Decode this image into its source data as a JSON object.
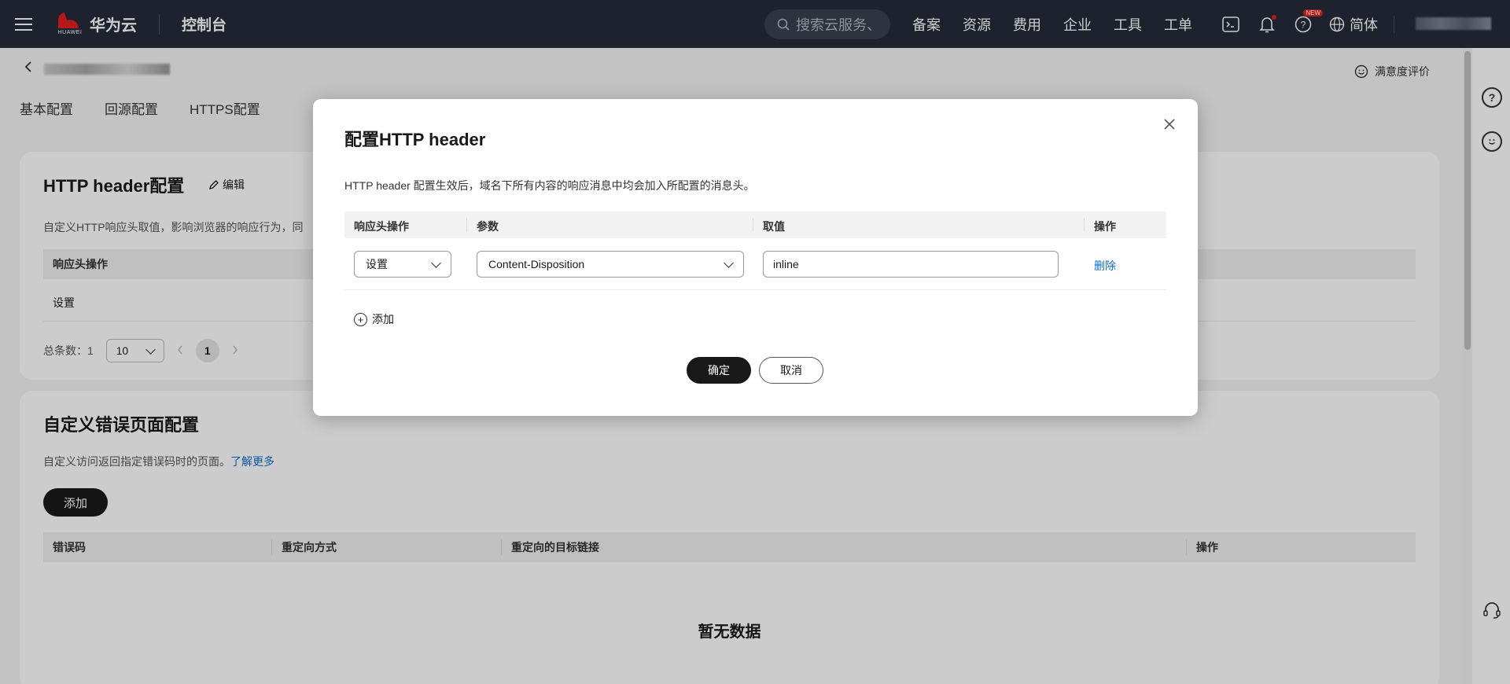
{
  "topnav": {
    "logo_text": "华为云",
    "logo_sub": "HUAWEI",
    "console": "控制台",
    "search_placeholder": "搜索云服务、",
    "links": [
      "备案",
      "资源",
      "费用",
      "企业",
      "工具",
      "工单"
    ],
    "new_badge": "NEW",
    "lang": "简体"
  },
  "page": {
    "satisfaction": "满意度评价",
    "tabs": [
      "基本配置",
      "回源配置",
      "HTTPS配置"
    ],
    "http_card": {
      "title": "HTTP header配置",
      "edit": "编辑",
      "desc": "自定义HTTP响应头取值，影响浏览器的响应行为，同",
      "col_op": "响应头操作",
      "row_op": "设置",
      "total_label": "总条数：1",
      "page_size": "10",
      "current_page": "1"
    },
    "error_card": {
      "title": "自定义错误页面配置",
      "desc": "自定义访问返回指定错误码时的页面。",
      "learn_more": "了解更多",
      "add_button": "添加",
      "columns": [
        "错误码",
        "重定向方式",
        "重定向的目标链接",
        "操作"
      ],
      "no_data": "暂无数据"
    }
  },
  "modal": {
    "title": "配置HTTP header",
    "desc": "HTTP header 配置生效后，域名下所有内容的响应消息中均会加入所配置的消息头。",
    "columns": [
      "响应头操作",
      "参数",
      "取值",
      "操作"
    ],
    "row": {
      "operation": "设置",
      "param": "Content-Disposition",
      "value": "inline",
      "delete": "删除"
    },
    "add": "添加",
    "ok": "确定",
    "cancel": "取消"
  },
  "colors": {
    "nav_bg": "#252b3a",
    "primary_btn": "#191919",
    "link": "#0f6ccf",
    "brand_red": "#e02020"
  }
}
